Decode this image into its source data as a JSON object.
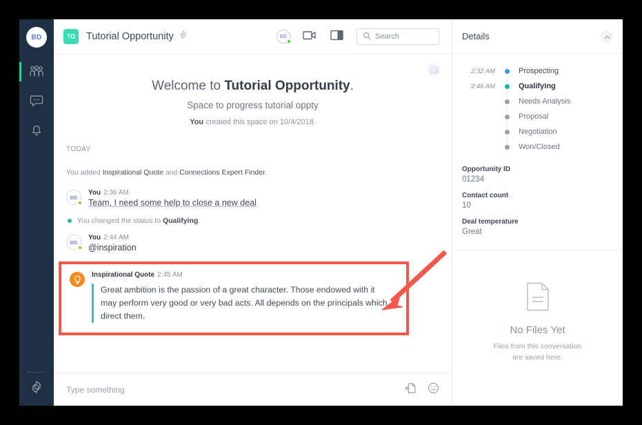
{
  "rail": {
    "avatar_initials": "BD",
    "items": [
      {
        "name": "teams",
        "icon": "people-icon",
        "active": true
      },
      {
        "name": "chat",
        "icon": "chat-bubble-icon",
        "active": false
      },
      {
        "name": "notifications",
        "icon": "bell-icon",
        "active": false
      }
    ],
    "settings_icon": "gear-icon"
  },
  "topbar": {
    "space_initials": "TO",
    "space_title": "Tutorial Opportunity",
    "settings_icon": "gear-icon",
    "user_initials": "BD",
    "video_icon": "video-camera-icon",
    "panel_icon": "layout-panel-icon",
    "search": {
      "placeholder": "Search",
      "value": "",
      "icon": "search-icon"
    }
  },
  "welcome": {
    "prefix": "Welcome to ",
    "space_name": "Tutorial Opportunity",
    "suffix": ".",
    "subtitle": "Space to progress tutorial oppty",
    "created_by": "You",
    "created_text": " created this space on 10/4/2018."
  },
  "stream": {
    "day_label": "TODAY",
    "system_added": {
      "prefix": "You added ",
      "app_one": "Inspirational Quote",
      "joiner": " and ",
      "app_two": "Connections Expert Finder",
      "suffix": "."
    },
    "messages": [
      {
        "avatar": "BD",
        "author": "You",
        "time": "2:36 AM",
        "text": "Team, I need some help to close a new deal",
        "style": "link"
      },
      {
        "avatar": "BD",
        "author": "You",
        "time": "2:44 AM",
        "text": "@inspiration",
        "style": "mention"
      }
    ],
    "status_change": {
      "prefix": "You changed the status to ",
      "status": "Qualifying",
      "suffix": "."
    },
    "quote_card": {
      "app_name": "Inspirational Quote",
      "time": "2:45 AM",
      "text": "Great ambition is the passion of a great character. Those endowed with it may perform very good or very bad acts. All depends on the principals which direct them.",
      "avatar_icon": "lightbulb-icon",
      "highlight_color": "#f4584b",
      "accent_color": "#2fc4c4"
    }
  },
  "composer": {
    "placeholder": "Type something",
    "attach_icon": "attach-file-icon",
    "emoji_icon": "smiley-icon"
  },
  "details": {
    "title": "Details",
    "collapse_icon": "chevron-up-icon",
    "stages": [
      {
        "time": "2:32 AM",
        "name": "Prospecting",
        "color": "#2f9bf0",
        "state": "done"
      },
      {
        "time": "2:46 AM",
        "name": "Qualifying",
        "color": "#18b9a0",
        "state": "current"
      },
      {
        "time": "",
        "name": "Needs Analysis",
        "color": "#9aa1ab",
        "state": "pending"
      },
      {
        "time": "",
        "name": "Proposal",
        "color": "#9aa1ab",
        "state": "pending"
      },
      {
        "time": "",
        "name": "Negotiation",
        "color": "#9aa1ab",
        "state": "pending"
      },
      {
        "time": "",
        "name": "Won/Closed",
        "color": "#9aa1ab",
        "state": "pending"
      }
    ],
    "fields": [
      {
        "key": "Opportunity ID",
        "value": "01234"
      },
      {
        "key": "Contact count",
        "value": "10"
      },
      {
        "key": "Deal temperature",
        "value": "Great"
      }
    ],
    "files": {
      "icon": "document-icon",
      "empty_title": "No Files Yet",
      "empty_line_one": "Files from this conversation",
      "empty_line_two": "are saved here."
    }
  },
  "annotation": {
    "arrow_color": "#f4584b"
  }
}
